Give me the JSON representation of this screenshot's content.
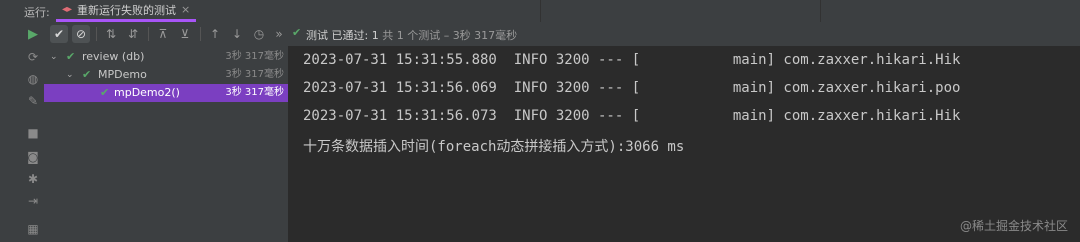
{
  "header": {
    "run_label": "运行:",
    "tab_label": "重新运行失败的测试",
    "tab_close": "×"
  },
  "status": {
    "prefix": "测试",
    "passed": "已通过: 1",
    "detail": "共 1 个测试 – 3秒 317毫秒"
  },
  "tree": [
    {
      "name": "review (db)",
      "time": "3秒 317毫秒",
      "selected": false
    },
    {
      "name": "MPDemo",
      "time": "3秒 317毫秒",
      "selected": false
    },
    {
      "name": "mpDemo2()",
      "time": "3秒 317毫秒",
      "selected": true
    }
  ],
  "console": {
    "lines": [
      "2023-07-31 15:31:55.880  INFO 3200 --- [           main] com.zaxxer.hikari.Hik",
      "2023-07-31 15:31:56.069  INFO 3200 --- [           main] com.zaxxer.hikari.poo",
      "2023-07-31 15:31:56.073  INFO 3200 --- [           main] com.zaxxer.hikari.Hik",
      "十万条数据插入时间(foreach动态拼接插入方式):3066 ms"
    ]
  },
  "watermark": "@稀土掘金技术社区",
  "colors": {
    "accent": "#7b3fc1",
    "success": "#59a869",
    "tab_underline": "#a855f7"
  },
  "icons": {
    "left": [
      "run-icon",
      "rerun-icon",
      "debug-icon",
      "wrench-icon",
      "stop-icon",
      "camera-icon",
      "bug-icon",
      "export-icon",
      "layout-icon"
    ],
    "toolbar": [
      "show-passed-icon",
      "show-ignored-icon",
      "sort-alpha-icon",
      "sort-duration-icon",
      "expand-all-icon",
      "collapse-all-icon",
      "prev-failed-icon",
      "next-failed-icon",
      "history-icon",
      "more-icon"
    ]
  }
}
